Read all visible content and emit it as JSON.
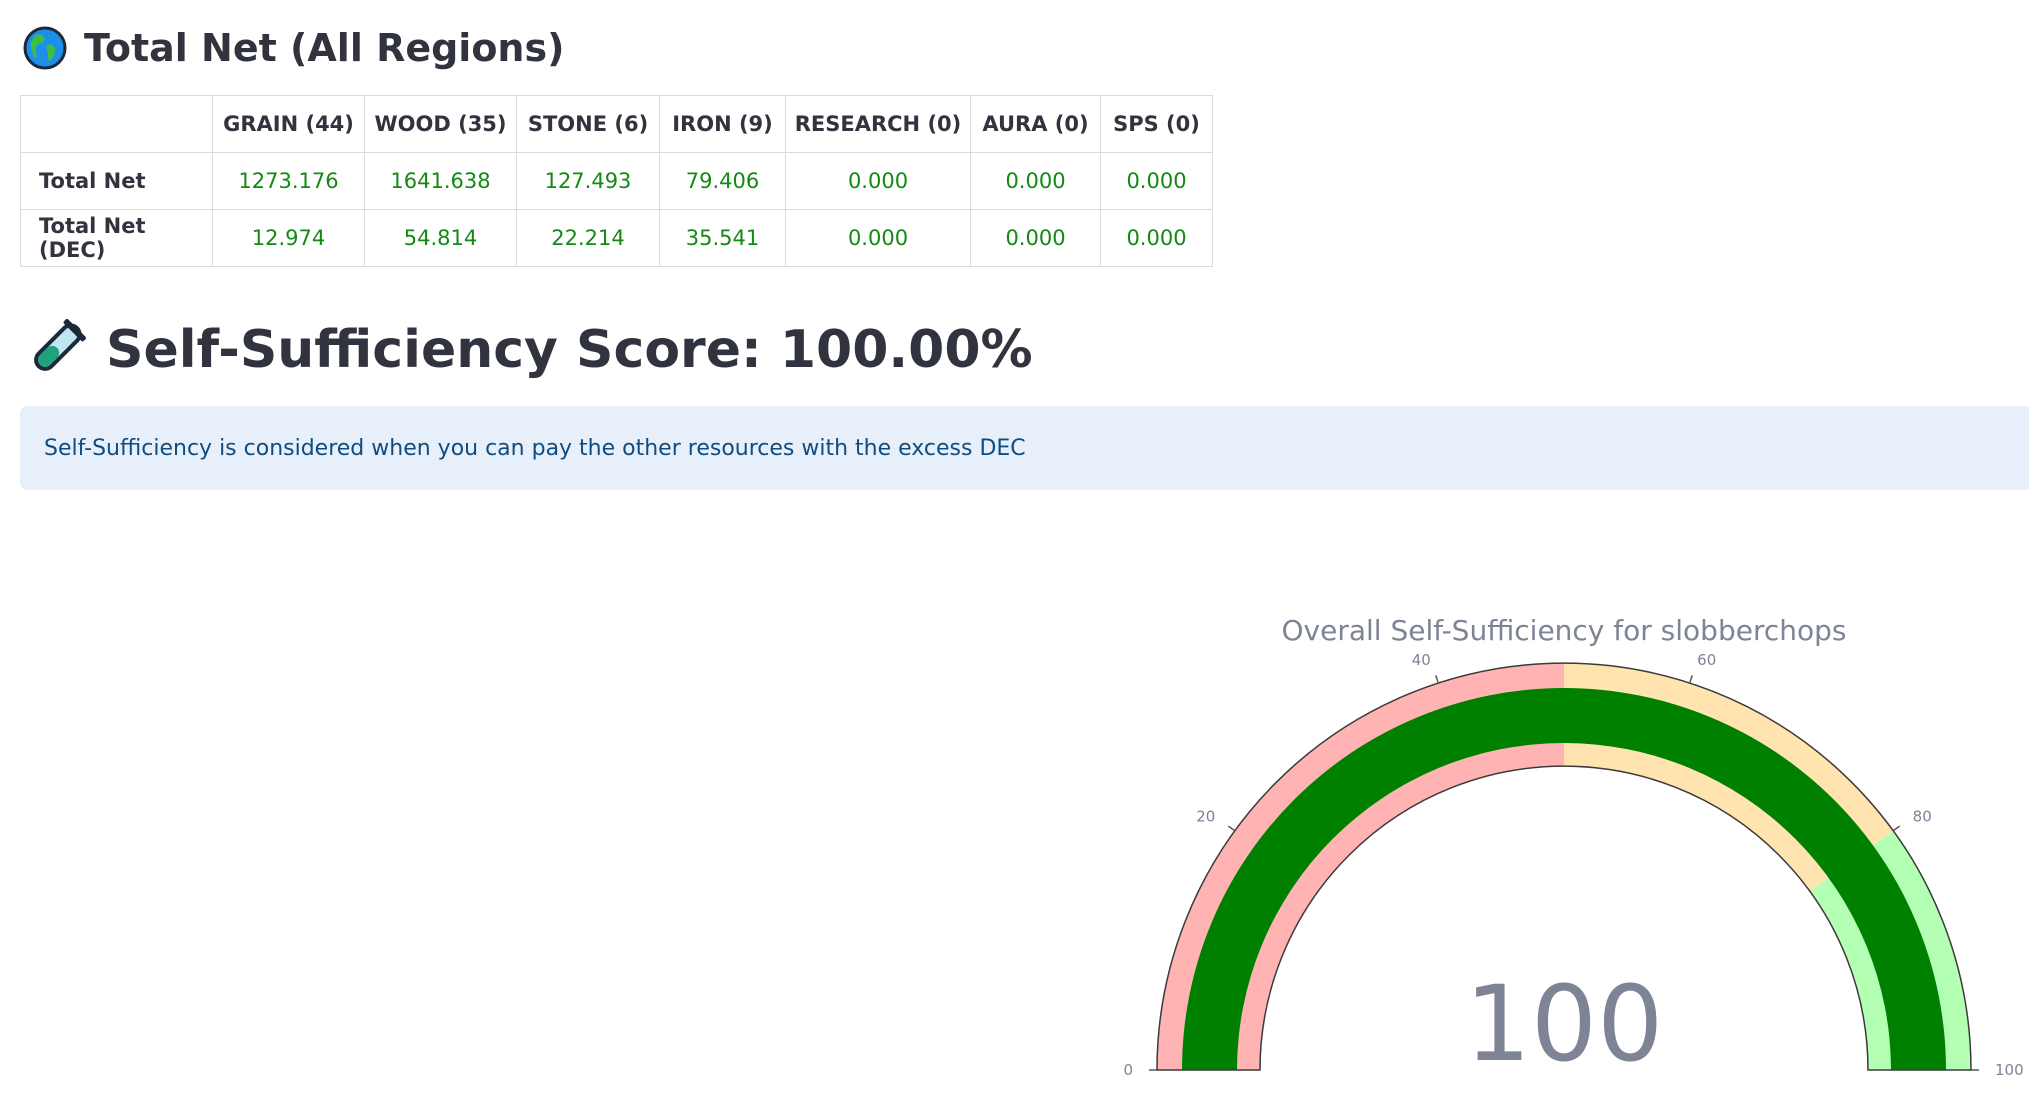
{
  "total_section": {
    "title": "Total Net (All Regions)",
    "icon": "globe-icon"
  },
  "net_table": {
    "columns": [
      "",
      "GRAIN (44)",
      "WOOD (35)",
      "STONE (6)",
      "IRON (9)",
      "RESEARCH (0)",
      "AURA (0)",
      "SPS (0)"
    ],
    "rows": [
      {
        "label": "Total Net",
        "values": [
          "1273.176",
          "1641.638",
          "127.493",
          "79.406",
          "0.000",
          "0.000",
          "0.000"
        ]
      },
      {
        "label": "Total Net (DEC)",
        "values": [
          "12.974",
          "54.814",
          "22.214",
          "35.541",
          "0.000",
          "0.000",
          "0.000"
        ]
      }
    ],
    "value_color": "#138a13"
  },
  "score_section": {
    "title": "Self-Sufficiency Score: 100.00%",
    "icon": "test-tube-icon"
  },
  "info_box": {
    "text": "Self-Sufficiency is considered when you can pay the other resources with the excess DEC",
    "background": "#e7f0fa",
    "text_color": "#0f4c81"
  },
  "gauge": {
    "title": "Overall Self-Sufficiency for slobberchops",
    "value": 100,
    "value_text": "100",
    "range": [
      0,
      100
    ],
    "ticks": [
      "0",
      "20",
      "40",
      "60",
      "80",
      "100"
    ],
    "steps": [
      {
        "range": [
          0,
          50
        ],
        "color": "#ffb3b3"
      },
      {
        "range": [
          50,
          80
        ],
        "color": "#ffe4b0"
      },
      {
        "range": [
          80,
          100
        ],
        "color": "#b3ffb3"
      }
    ],
    "bar_color": "#008000"
  }
}
